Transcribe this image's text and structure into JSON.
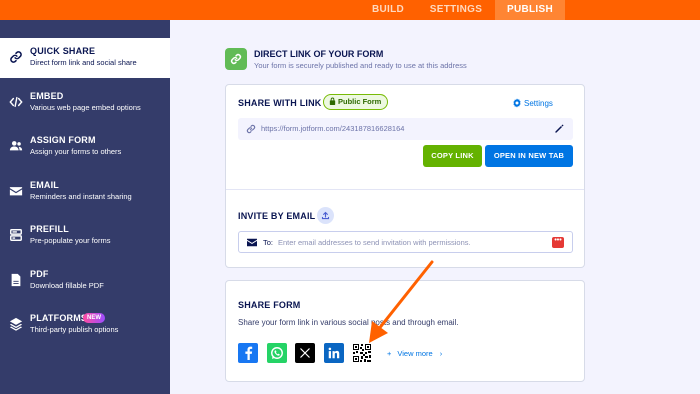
{
  "topbar": {
    "tabs": [
      {
        "label": "BUILD"
      },
      {
        "label": "SETTINGS"
      },
      {
        "label": "PUBLISH",
        "active": true
      }
    ]
  },
  "sidebar": {
    "items": [
      {
        "title": "QUICK SHARE",
        "subtitle": "Direct form link and social share",
        "icon": "link-icon",
        "active": true
      },
      {
        "title": "EMBED",
        "subtitle": "Various web page embed options",
        "icon": "code-icon"
      },
      {
        "title": "ASSIGN FORM",
        "subtitle": "Assign your forms to others",
        "icon": "users-icon"
      },
      {
        "title": "EMAIL",
        "subtitle": "Reminders and instant sharing",
        "icon": "envelope-icon"
      },
      {
        "title": "PREFILL",
        "subtitle": "Pre-populate your forms",
        "icon": "prefill-icon"
      },
      {
        "title": "PDF",
        "subtitle": "Download fillable PDF",
        "icon": "pdf-icon"
      },
      {
        "title": "PLATFORMS",
        "subtitle": "Third-party publish options",
        "icon": "layers-icon",
        "badge": "NEW"
      }
    ]
  },
  "header": {
    "title": "DIRECT LINK OF YOUR FORM",
    "subtitle": "Your form is securely published and ready to use at this address"
  },
  "share_link": {
    "title": "SHARE WITH LINK",
    "status": "Public Form",
    "settings_label": "Settings",
    "url": "https://form.jotform.com/243187816628164",
    "copy_label": "COPY LINK",
    "open_label": "OPEN IN NEW TAB"
  },
  "invite": {
    "title": "INVITE BY EMAIL",
    "to_label": "To:",
    "placeholder": "Enter email addresses to send invitation with permissions."
  },
  "share_form": {
    "title": "SHARE FORM",
    "description": "Share your form link in various social posts and through email.",
    "socials": [
      "facebook-icon",
      "whatsapp-icon",
      "x-icon",
      "linkedin-icon",
      "qr-code-icon"
    ],
    "view_more": "View more"
  },
  "colors": {
    "topbar": "#ff6100",
    "sidebar": "#343c6a",
    "copy_button": "#64b200",
    "open_button": "#0075e3",
    "annotation_arrow": "#ff6100"
  }
}
